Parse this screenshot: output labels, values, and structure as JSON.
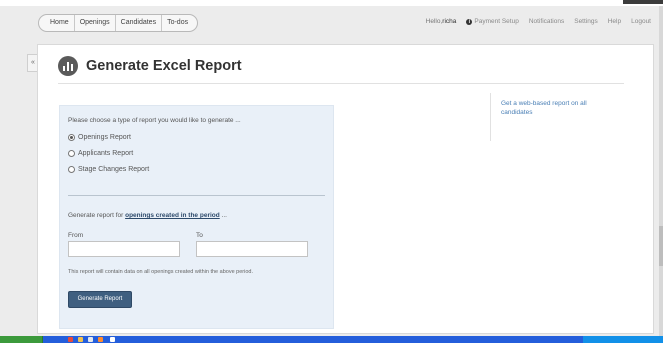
{
  "nav": {
    "tabs": [
      "Home",
      "Openings",
      "Candidates",
      "To-dos"
    ]
  },
  "header_right": {
    "greeting_prefix": "Hello,",
    "user": "richa",
    "payment_setup": "Payment Setup",
    "notifications": "Notifications",
    "settings": "Settings",
    "help": "Help",
    "logout": "Logout"
  },
  "sidebar": {
    "collapse_glyph": "«"
  },
  "page": {
    "title": "Generate Excel Report",
    "icon": "report-chart-icon"
  },
  "form": {
    "prompt": "Please choose a type of report you would like to generate ...",
    "report_types": [
      {
        "label": "Openings Report",
        "selected": true
      },
      {
        "label": "Applicants Report",
        "selected": false
      },
      {
        "label": "Stage Changes Report",
        "selected": false
      }
    ],
    "period_prefix": "Generate report for",
    "period_link": "openings created in the period",
    "period_suffix": "...",
    "from_label": "From",
    "to_label": "To",
    "from_value": "",
    "to_value": "",
    "note": "This report will contain data on all openings created within the above period.",
    "submit": "Generate Report"
  },
  "side": {
    "link": "Get a web-based report on all candidates"
  },
  "colors": {
    "button": "#3f5f80",
    "form_background": "#e9f0f8",
    "link": "#4a7fb5",
    "taskbar": "#245edb"
  }
}
